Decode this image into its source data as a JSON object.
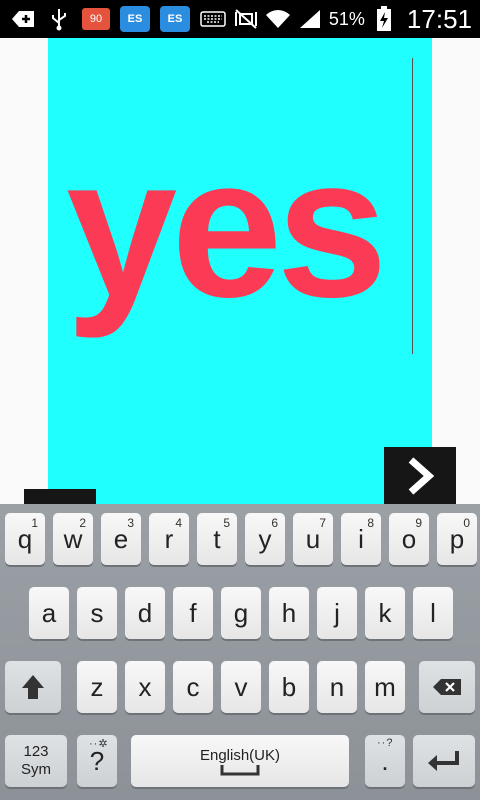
{
  "status_bar": {
    "badge_text": "90",
    "app_icon_label": "ES",
    "battery_percent": "51%",
    "time": "17:51"
  },
  "canvas": {
    "word": "yes",
    "background_color": "#1efffe",
    "text_color": "#fb3a55"
  },
  "keyboard": {
    "row1": [
      {
        "label": "q",
        "num": "1"
      },
      {
        "label": "w",
        "num": "2"
      },
      {
        "label": "e",
        "num": "3"
      },
      {
        "label": "r",
        "num": "4"
      },
      {
        "label": "t",
        "num": "5"
      },
      {
        "label": "y",
        "num": "6"
      },
      {
        "label": "u",
        "num": "7"
      },
      {
        "label": "i",
        "num": "8"
      },
      {
        "label": "o",
        "num": "9"
      },
      {
        "label": "p",
        "num": "0"
      }
    ],
    "row2": [
      "a",
      "s",
      "d",
      "f",
      "g",
      "h",
      "j",
      "k",
      "l"
    ],
    "row3": [
      "z",
      "x",
      "c",
      "v",
      "b",
      "n",
      "m"
    ],
    "sym_label_1": "123",
    "sym_label_2": "Sym",
    "question": "?",
    "space_label": "English(UK)",
    "period": "."
  }
}
